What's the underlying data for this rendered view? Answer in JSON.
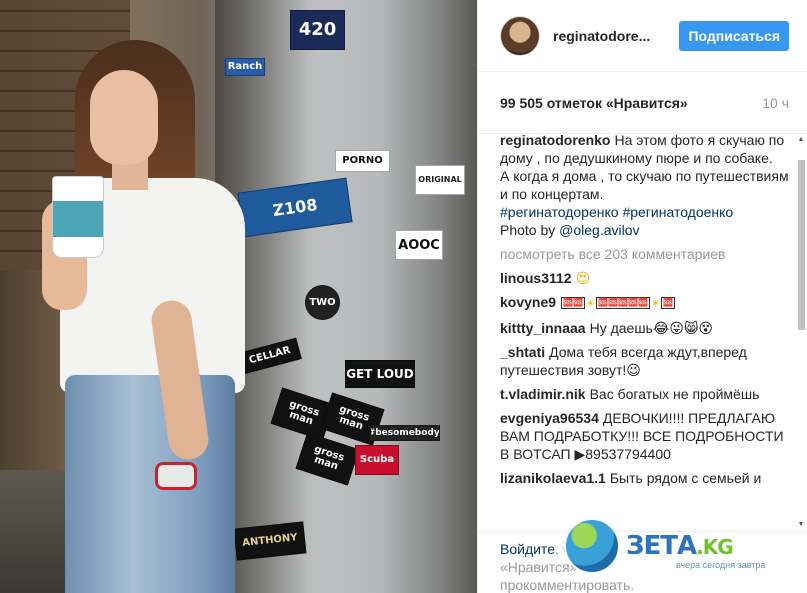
{
  "photo": {
    "stickers": [
      "420",
      "Z108",
      "PORNO",
      "AOOC",
      "GET LOUD",
      "CELLAR",
      "gross man",
      "gross man",
      "gross man",
      "#besomebody.",
      "Scuba",
      "ANTHONY",
      "Ranch",
      "TWO",
      "ORIGINAL"
    ]
  },
  "header": {
    "username": "reginatodore...",
    "follow_label": "Подписаться"
  },
  "stats": {
    "likes": "99 505 отметок «Нравится»",
    "time": "10 ч"
  },
  "caption": {
    "user": "reginatodorenko",
    "line1": "На этом фото я скучаю по дому , по дедушкиному пюре и по собаке.",
    "line2": "А когда я дома , то скучаю по путешествиям и по концертам.",
    "hashtags": "#регинатодоренко #регинатодоенко",
    "photo_by": "Photo by",
    "photo_by_user": "@oleg.avilov"
  },
  "more_comments": "посмотреть все 203 комментариев",
  "comments": [
    {
      "user": "linous3112",
      "text": "😍"
    },
    {
      "user": "kovyne9",
      "text": ""
    },
    {
      "user": "kittty_innaaa",
      "text": "Ну даешь😂😜😸😵"
    },
    {
      "user": "_shtati",
      "text": "Дома тебя всегда ждут,вперед путешествия зовут!😉"
    },
    {
      "user": "t.vladimir.nik",
      "text": "Вас богатых не проймёшь"
    },
    {
      "user": "evgeniya96534",
      "text": "ДЕВОЧКИ!!!! ПРЕДЛАГАЮ ВАМ ПОДРАБОТКУ!!! ВСЕ ПОДРОБНОСТИ В ВОТСАП ▶89537794400"
    },
    {
      "user": "lizanikolaeva1.1",
      "text": "Быть рядом с семьей и"
    }
  ],
  "kovyne9_parts": [
    "🆘🆘",
    "✴",
    "🆘🆘🆘🆘🆘",
    "✴",
    "🆘"
  ],
  "footer": {
    "login_link": "Войдите",
    "text_after_link": ", чтобы",
    "line2": "«Нравится» и",
    "line3": "прокомментировать."
  },
  "watermark": {
    "brand": "ЗЕТА",
    "tld": ".KG",
    "tagline": "вчера сегодня завтра"
  },
  "colors": {
    "follow_button": "#3897f0",
    "link": "#003569",
    "muted": "#999999",
    "text": "#262626"
  }
}
